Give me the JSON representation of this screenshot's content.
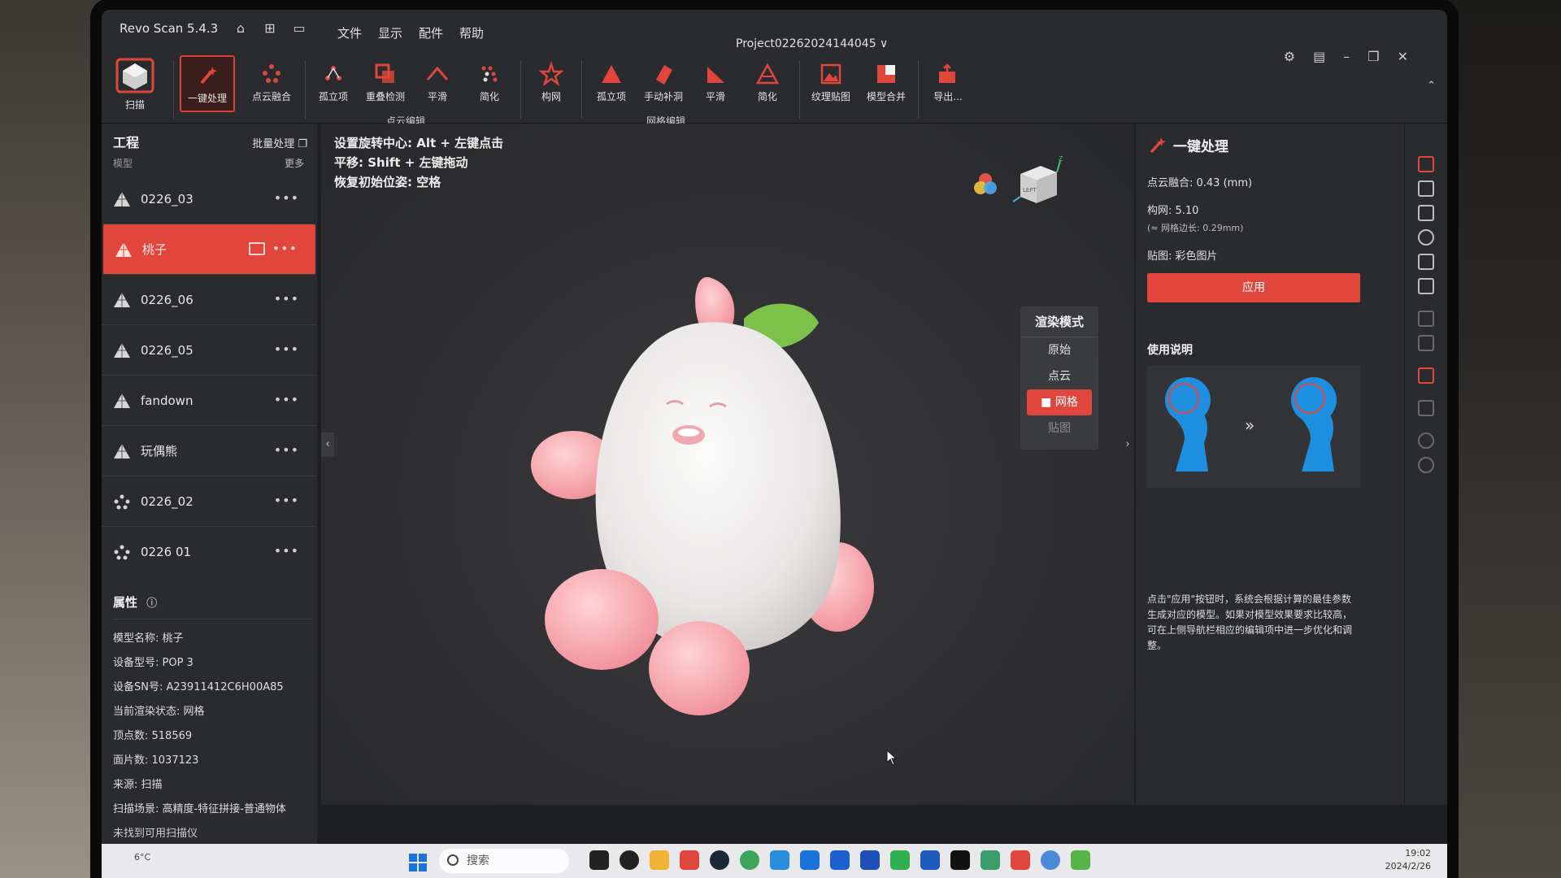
{
  "app": {
    "title": "Revo Scan 5.4.3",
    "menu": [
      "文件",
      "显示",
      "配件",
      "帮助"
    ],
    "project": "Project0226202414404​5 ∨"
  },
  "ribbon": {
    "scan": "扫描",
    "tools_pc": [
      "一键处理",
      "点云融合",
      "孤立项",
      "重叠检测",
      "平滑",
      "简化"
    ],
    "group_pc": "点云编辑",
    "tools_mesh": [
      "构网",
      "孤立项",
      "手动补洞",
      "平滑",
      "简化"
    ],
    "group_mesh": "网格编辑",
    "tools_extra": [
      "纹理贴图",
      "模型合并",
      "导出..."
    ]
  },
  "left_panel": {
    "header": "工程",
    "batch": "批量处理",
    "sub": "模型",
    "more": "更多",
    "models": [
      {
        "name": "0226_03",
        "type": "mesh"
      },
      {
        "name": "桃子",
        "type": "mesh"
      },
      {
        "name": "0226_06",
        "type": "mesh"
      },
      {
        "name": "0226_05",
        "type": "mesh"
      },
      {
        "name": "fandown",
        "type": "mesh"
      },
      {
        "name": "玩偶熊",
        "type": "mesh"
      },
      {
        "name": "0226_02",
        "type": "points"
      },
      {
        "name": "0226 01",
        "type": "points"
      }
    ],
    "dots": "•••",
    "props_title": "属性",
    "props": [
      "模型名称: 桃子",
      "设备型号: POP 3",
      "设备SN号: A23911412C6H00A85",
      "当前渲染状态: 网格",
      "顶点数: 518569",
      "面片数: 1037123",
      "来源: 扫描",
      "扫描场景: 高精度-特征拼接-普通物体"
    ],
    "status": "未找到可用扫描仪"
  },
  "viewport": {
    "hints": [
      "设置旋转中心: Alt + 左键点击",
      "平移: Shift + 左键拖动",
      "恢复初始位姿: 空格"
    ],
    "render_mode_title": "渲染模式",
    "render_modes": [
      "原始",
      "点云",
      "网格",
      "贴图"
    ],
    "selected_mode": "网格",
    "gizmo_label": "LEFT",
    "axis_z": "Z"
  },
  "right_panel": {
    "title": "一键处理",
    "rows": [
      "点云融合:  0.43 (mm)",
      "构网:  5.10",
      "(≈ 网格边长: 0.29mm)",
      "贴图: 彩色图片"
    ],
    "apply": "应用",
    "usage": "使用说明",
    "desc": "点击\"应用\"按钮时，系统会根据计算的最佳参数生成对应的模型。如果对模型效果要求比较高，可在上侧导航栏相应的编辑项中进一步优化和调整。"
  },
  "taskbar": {
    "weather": "6°C",
    "search": "搜索",
    "time": "19:02",
    "date": "2024/2/26"
  },
  "colors": {
    "accent": "#e0463b",
    "panel": "#2a2b2e",
    "viewport": "#333336"
  }
}
